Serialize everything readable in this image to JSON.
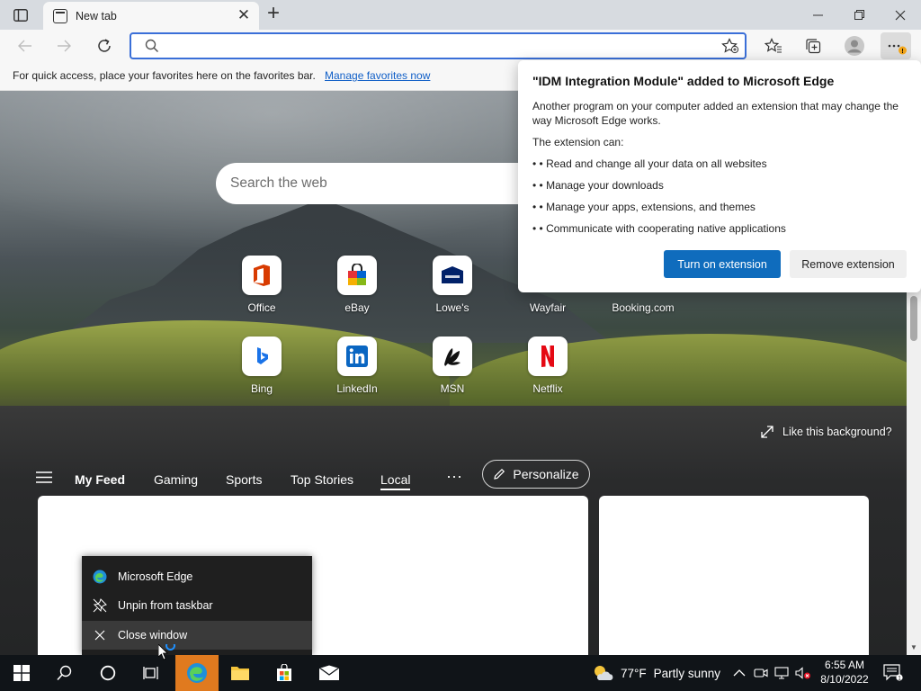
{
  "browser": {
    "tab_title": "New tab",
    "address_value": "",
    "address_placeholder": ""
  },
  "favorites_bar": {
    "message": "For quick access, place your favorites here on the favorites bar.",
    "link": "Manage favorites now"
  },
  "newtab": {
    "search_placeholder": "Search the web",
    "quick_links": [
      {
        "label": "Office"
      },
      {
        "label": "eBay"
      },
      {
        "label": "Lowe's"
      },
      {
        "label": "Wayfair"
      },
      {
        "label": "Booking.com"
      },
      {
        "label": "Bing"
      },
      {
        "label": "LinkedIn"
      },
      {
        "label": "MSN"
      },
      {
        "label": "Netflix"
      }
    ],
    "like_background": "Like this background?",
    "feed_tabs": [
      "My Feed",
      "Gaming",
      "Sports",
      "Top Stories",
      "Local"
    ],
    "personalize": "Personalize"
  },
  "popup": {
    "title": "\"IDM Integration Module\" added to Microsoft Edge",
    "description": "Another program on your computer added an extension that may change the way Microsoft Edge works.",
    "can_heading": "The extension can:",
    "permissions": [
      "• • Read and change all your data on all websites",
      "• • Manage your downloads",
      "• • Manage your apps, extensions, and themes",
      "• • Communicate with cooperating native applications"
    ],
    "turn_on": "Turn on extension",
    "remove": "Remove extension"
  },
  "jumplist": {
    "items": [
      "Microsoft Edge",
      "Unpin from taskbar",
      "Close window"
    ]
  },
  "taskbar": {
    "weather_temp": "77°F",
    "weather_desc": "Partly sunny",
    "time": "6:55 AM",
    "date": "8/10/2022"
  },
  "colors": {
    "accent": "#0f6cbd",
    "address_focus": "#3a6fd8",
    "taskbar": "#101418",
    "edge_active": "#e07a1f"
  }
}
